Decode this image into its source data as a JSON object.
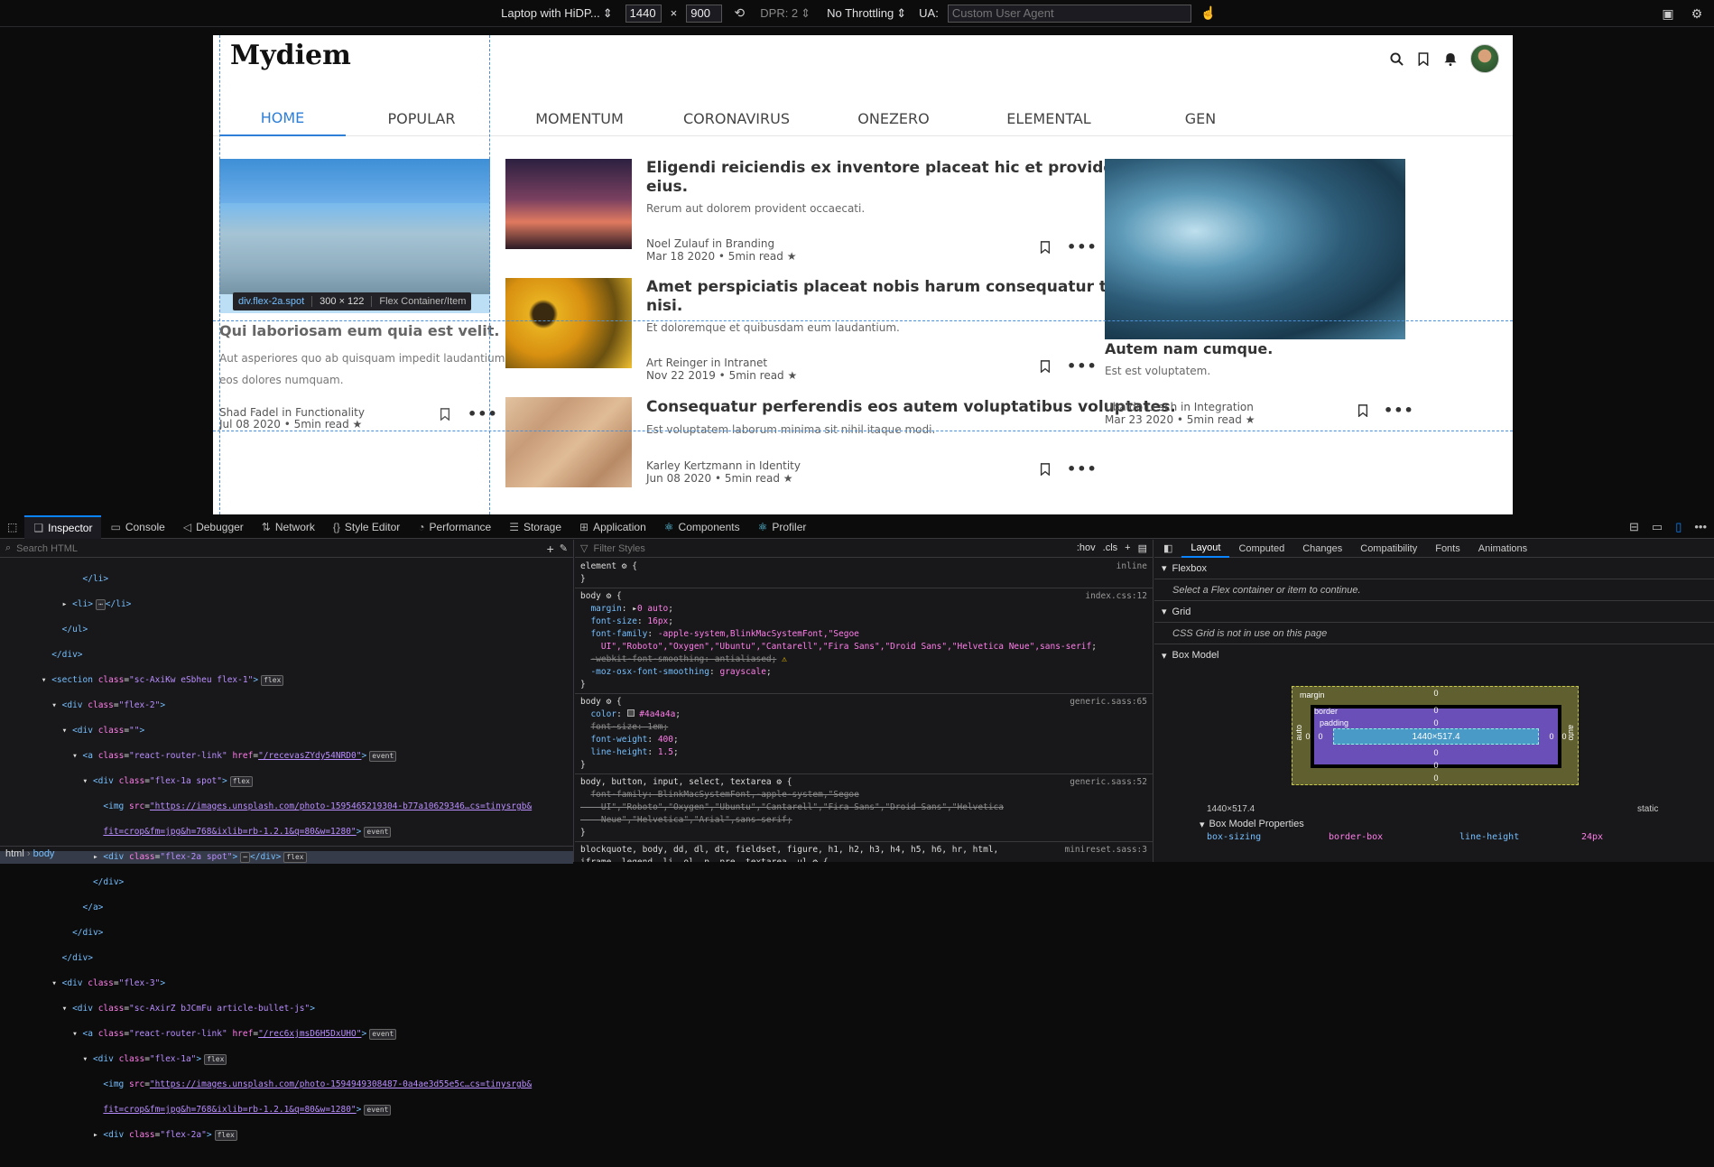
{
  "rdm": {
    "device": "Laptop with HiDP...",
    "width": "1440",
    "height": "900",
    "x_sep": "×",
    "dpr": "DPR: 2",
    "throttling": "No Throttling",
    "ua_label": "UA:",
    "ua_placeholder": "Custom User Agent"
  },
  "site": {
    "logo": "Mydiem",
    "nav": [
      "HOME",
      "POPULAR",
      "MOMENTUM",
      "CORONAVIRUS",
      "ONEZERO",
      "ELEMENTAL",
      "GEN"
    ],
    "hero": {
      "title": "Qui laboriosam eum quia est velit.",
      "sub1": "Aut asperiores quo ab quisquam impedit laudantium",
      "sub2": "eos dolores numquam.",
      "author": "Shad Fadel in Functionality",
      "date": "Jul 08 2020 • 5min read ★"
    },
    "articles": [
      {
        "title1": "Eligendi reiciendis ex inventore placeat hic et provident ex",
        "title2": "eius.",
        "sub": "Rerum aut dolorem provident occaecati.",
        "author": "Noel Zulauf in Branding",
        "date": "Mar 18 2020 • 5min read ★"
      },
      {
        "title1": "Amet perspiciatis placeat nobis harum consequatur tenetur et",
        "title2": "nisi.",
        "sub": "Et doloremque et quibusdam eum laudantium.",
        "author": "Art Reinger in Intranet",
        "date": "Nov 22 2019 • 5min read ★"
      },
      {
        "title1": "Consequatur perferendis eos autem voluptatibus voluptates.",
        "title2": "",
        "sub": "Est voluptatem laborum minima sit nihil itaque modi.",
        "author": "Karley Kertzmann in Identity",
        "date": "Jun 08 2020 • 5min read ★"
      }
    ],
    "right": {
      "title": "Autem nam cumque.",
      "sub": "Est est voluptatem.",
      "author": "Ubaldo Lesch in Integration",
      "date": "Mar 23 2020 • 5min read ★"
    }
  },
  "tooltip": {
    "name": "div.flex-2a.spot",
    "size": "300 × 122",
    "type": "Flex Container/Item"
  },
  "devtools": {
    "tabs": [
      "Inspector",
      "Console",
      "Debugger",
      "Network",
      "Style Editor",
      "Performance",
      "Storage",
      "Application",
      "Components",
      "Profiler"
    ],
    "search_placeholder": "Search HTML",
    "filter_placeholder": "Filter Styles",
    "hov": ":hov",
    "cls": ".cls",
    "crumb1": "html",
    "crumb2": "body",
    "layout_tabs": [
      "Layout",
      "Computed",
      "Changes",
      "Compatibility",
      "Fonts",
      "Animations"
    ],
    "flexbox": "Flexbox",
    "flexbox_note": "Select a Flex container or item to continue.",
    "grid": "Grid",
    "grid_note": "CSS Grid is not in use on this page",
    "boxmodel": "Box Model",
    "bm_margin": "margin",
    "bm_border": "border",
    "bm_padding": "padding",
    "bm_content": "1440×517.4",
    "bm_auto": "auto",
    "bm_zero": "0",
    "bm_size": "1440×517.4",
    "bm_position": "static",
    "bm_props": "Box Model Properties",
    "prop1_name": "box-sizing",
    "prop1_val": "border-box",
    "prop2_name": "line-height",
    "prop2_val": "24px"
  }
}
